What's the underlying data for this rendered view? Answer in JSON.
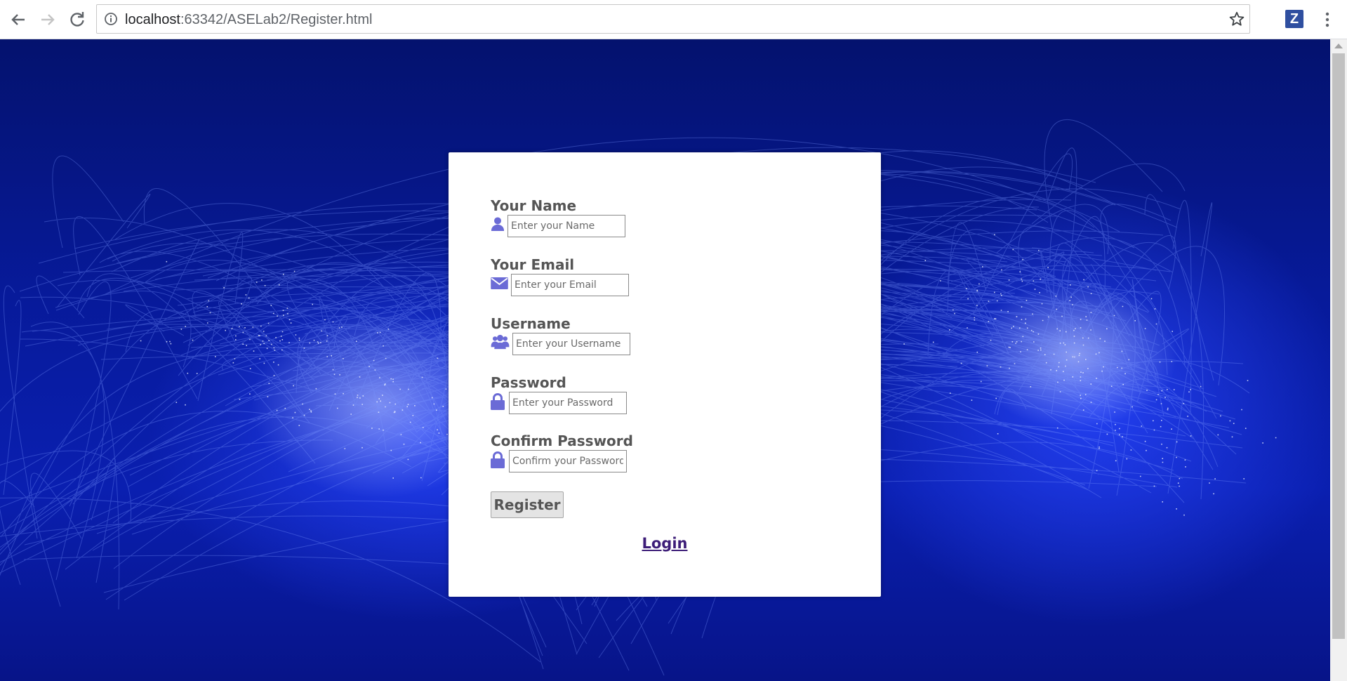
{
  "browser": {
    "url_host": "localhost",
    "url_rest": ":63342/ASELab2/Register.html",
    "extension_letter": "Z"
  },
  "form": {
    "fields": [
      {
        "label": "Your Name",
        "placeholder": "Enter your Name",
        "icon": "user-icon"
      },
      {
        "label": "Your Email",
        "placeholder": "Enter your Email",
        "icon": "envelope-icon"
      },
      {
        "label": "Username",
        "placeholder": "Enter your Username",
        "icon": "users-icon"
      },
      {
        "label": "Password",
        "placeholder": "Enter your Password",
        "icon": "lock-icon"
      },
      {
        "label": "Confirm Password",
        "placeholder": "Confirm your Password",
        "icon": "lock-icon"
      }
    ],
    "register_label": "Register",
    "login_label": "Login"
  },
  "colors": {
    "icon": "#6b6bd6",
    "background": "#0a1fb0",
    "link": "#3d1d78"
  }
}
